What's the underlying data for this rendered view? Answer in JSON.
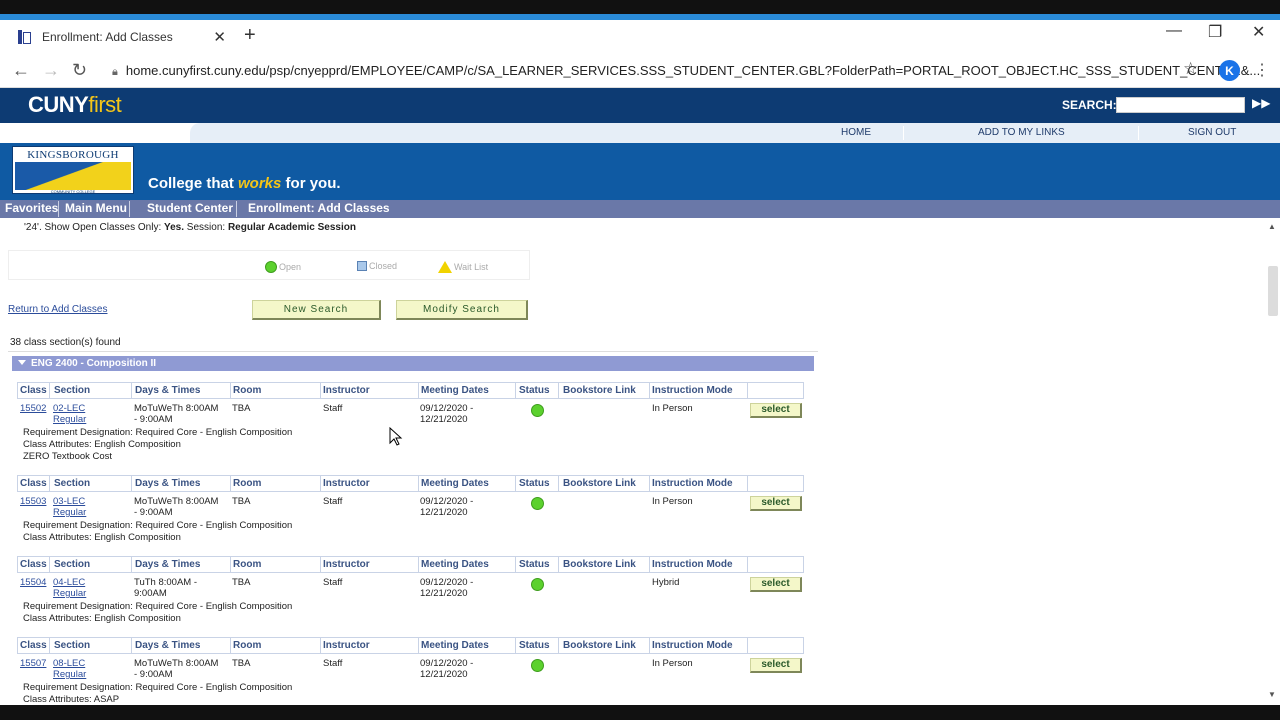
{
  "browser": {
    "tab_title": "Enrollment: Add Classes",
    "url": "home.cunyfirst.cuny.edu/psp/cnyepprd/EMPLOYEE/CAMP/c/SA_LEARNER_SERVICES.SSS_STUDENT_CENTER.GBL?FolderPath=PORTAL_ROOT_OBJECT.HC_SSS_STUDENT_CENTER&...",
    "profile_initial": "K"
  },
  "header": {
    "logo_main": "CUNY",
    "logo_accent": "first",
    "search_label": "SEARCH:",
    "links": [
      "HOME",
      "ADD TO MY LINKS",
      "SIGN OUT"
    ]
  },
  "banner": {
    "college_name": "KINGSBOROUGH",
    "college_sub": "COMMUNITY COLLEGE",
    "tagline_pre": "College that ",
    "tagline_em": "works",
    "tagline_post": " for you."
  },
  "breadcrumb": [
    "Favorites",
    "Main Menu",
    "Student Center",
    "Enrollment: Add Classes"
  ],
  "criteria": {
    "prefix": "'24'.  Show Open Classes Only: ",
    "open_only": "Yes.",
    "session_label": "  Session: ",
    "session": "Regular Academic Session"
  },
  "legend": {
    "open": "Open",
    "closed": "Closed",
    "wait": "Wait List"
  },
  "actions": {
    "return": "Return to Add Classes",
    "new_search": "New Search",
    "modify_search": "Modify Search"
  },
  "results": {
    "found": "38 class section(s) found",
    "course": "ENG 2400 - Composition II"
  },
  "columns": [
    "Class",
    "Section",
    "Days & Times",
    "Room",
    "Instructor",
    "Meeting Dates",
    "Status",
    "Bookstore Link",
    "Instruction Mode"
  ],
  "sections": [
    {
      "class": "15502",
      "section": "02-LEC",
      "sub": "Regular",
      "days1": "MoTuWeTh 8:00AM",
      "days2": "- 9:00AM",
      "room": "TBA",
      "instructor": "Staff",
      "dates1": "09/12/2020 -",
      "dates2": "12/21/2020",
      "mode": "In Person",
      "select": "select",
      "notes": [
        "Requirement Designation: Required Core - English Composition",
        "Class Attributes: English Composition",
        "ZERO Textbook Cost"
      ]
    },
    {
      "class": "15503",
      "section": "03-LEC",
      "sub": "Regular",
      "days1": "MoTuWeTh 8:00AM",
      "days2": "- 9:00AM",
      "room": "TBA",
      "instructor": "Staff",
      "dates1": "09/12/2020 -",
      "dates2": "12/21/2020",
      "mode": "In Person",
      "select": "select",
      "notes": [
        "Requirement Designation: Required Core - English Composition",
        "Class Attributes: English Composition"
      ]
    },
    {
      "class": "15504",
      "section": "04-LEC",
      "sub": "Regular",
      "days1": "TuTh 8:00AM -",
      "days2": "9:00AM",
      "room": "TBA",
      "instructor": "Staff",
      "dates1": "09/12/2020 -",
      "dates2": "12/21/2020",
      "mode": "Hybrid",
      "select": "select",
      "notes": [
        "Requirement Designation: Required Core - English Composition",
        "Class Attributes: English Composition"
      ]
    },
    {
      "class": "15507",
      "section": "08-LEC",
      "sub": "Regular",
      "days1": "MoTuWeTh 8:00AM",
      "days2": "- 9:00AM",
      "room": "TBA",
      "instructor": "Staff",
      "dates1": "09/12/2020 -",
      "dates2": "12/21/2020",
      "mode": "In Person",
      "select": "select",
      "notes": [
        "Requirement Designation: Required Core - English Composition",
        "Class Attributes: ASAP"
      ]
    }
  ]
}
